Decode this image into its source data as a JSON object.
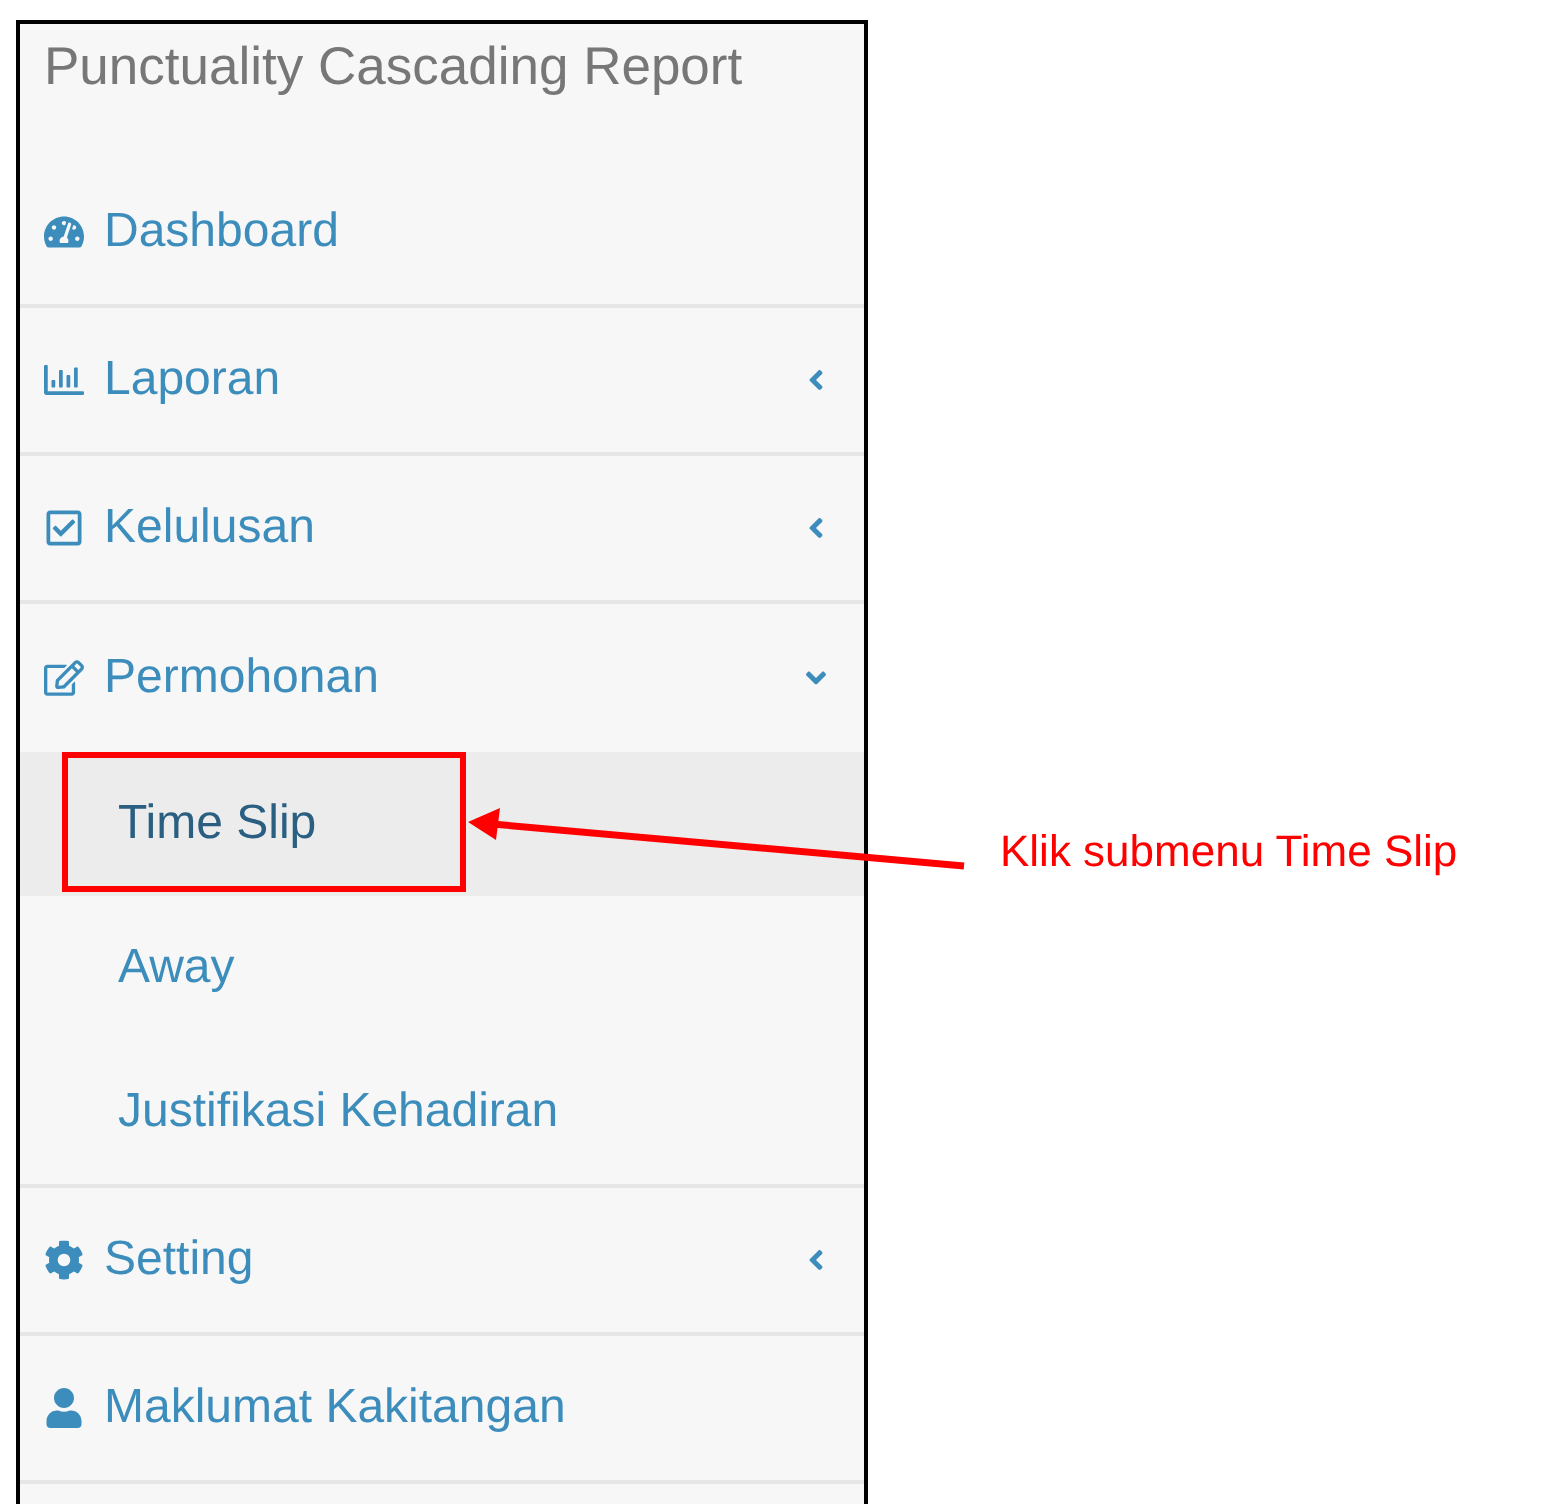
{
  "sidebar": {
    "title": "Punctuality Cascading Report",
    "menu": [
      {
        "label": "Dashboard"
      },
      {
        "label": "Laporan",
        "expanded": false
      },
      {
        "label": "Kelulusan",
        "expanded": false
      },
      {
        "label": "Permohonan",
        "expanded": true,
        "children": [
          {
            "label": "Time Slip",
            "selected": true
          },
          {
            "label": "Away",
            "selected": false
          },
          {
            "label": "Justifikasi Kehadiran",
            "selected": false
          }
        ]
      },
      {
        "label": "Setting",
        "expanded": false
      },
      {
        "label": "Maklumat Kakitangan"
      }
    ]
  },
  "annotation": {
    "text": "Klik submenu Time Slip"
  }
}
